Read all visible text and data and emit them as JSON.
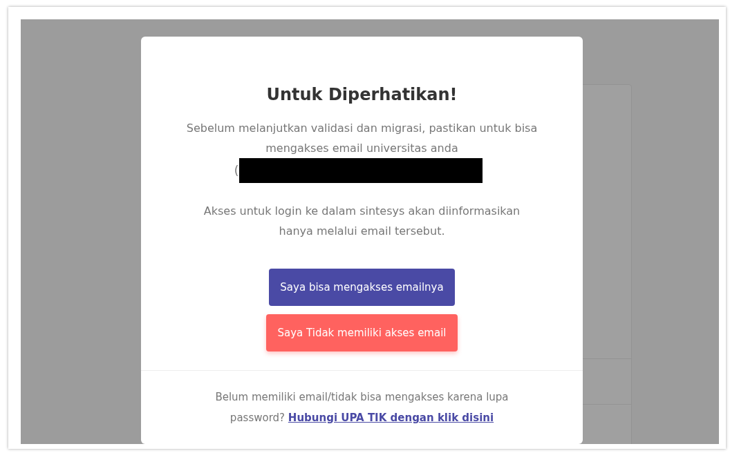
{
  "modal": {
    "title": "Untuk Diperhatikan!",
    "message": "Sebelum melanjutkan validasi dan migrasi, pastikan untuk bisa mengakses email universitas anda",
    "email_visible": "(",
    "note": "Akses untuk login ke dalam sintesys akan diinformasikan hanya melalui email tersebut.",
    "buttons": [
      {
        "label": "Saya bisa mengakses emailnya",
        "kind": "primary"
      },
      {
        "label": "Saya Tidak memiliki akses email",
        "kind": "danger"
      }
    ],
    "footer": {
      "text": "Belum memiliki email/tidak bisa mengakses karena lupa password?",
      "link": "Hubungi UPA TIK dengan klik disini"
    }
  }
}
